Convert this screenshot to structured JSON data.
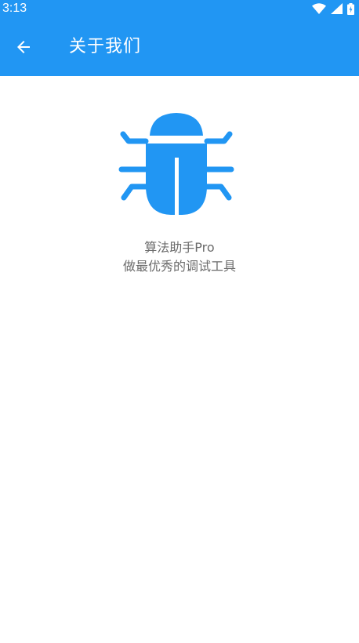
{
  "status_bar": {
    "time": "3:13",
    "icons": [
      "wifi-icon",
      "signal-icon",
      "battery-charging-icon"
    ]
  },
  "app_bar": {
    "back_icon": "arrow-left-icon",
    "title": "关于我们"
  },
  "about": {
    "logo_icon": "bug-icon",
    "app_name": "算法助手Pro",
    "slogan": "做最优秀的调试工具"
  },
  "colors": {
    "primary": "#2196f3",
    "logo": "#2196f3",
    "text_secondary": "#6b6b6b",
    "background": "#ffffff"
  }
}
